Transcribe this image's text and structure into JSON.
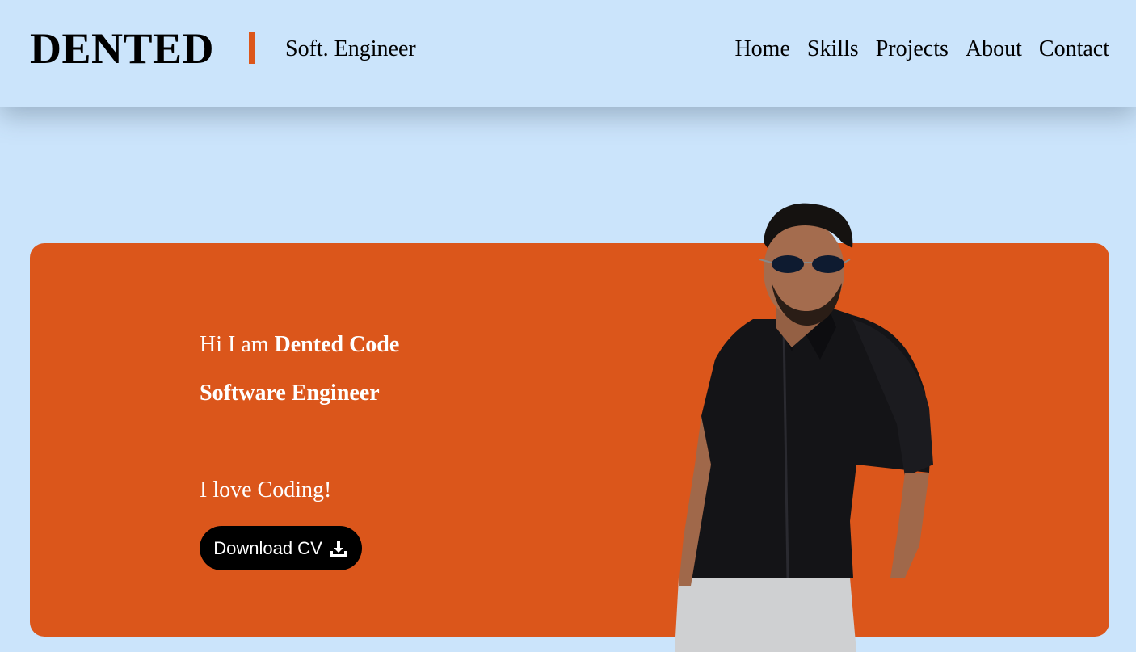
{
  "header": {
    "logo": "DENTED",
    "tagline": "Soft. Engineer",
    "nav": [
      "Home",
      "Skills",
      "Projects",
      "About",
      "Contact"
    ]
  },
  "hero": {
    "greeting_prefix": "Hi I am ",
    "name": "Dented Code",
    "role": "Software Engineer",
    "motto": "I love Coding!",
    "cv_label": "Download CV",
    "cv_icon": "download-icon"
  },
  "colors": {
    "background": "#cbe4fb",
    "accent": "#db561b",
    "button": "#000000"
  }
}
